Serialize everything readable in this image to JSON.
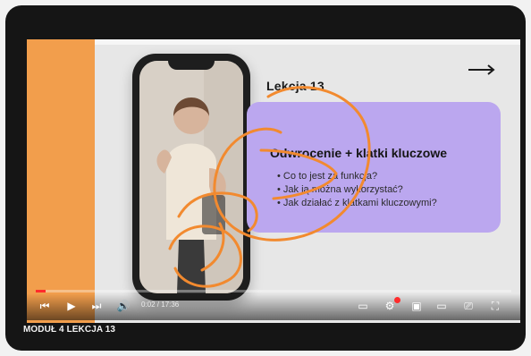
{
  "video": {
    "lesson_title": "Lekcja 13",
    "card_heading": "Odwrocenie + klatki kluczowe",
    "bullets": [
      "Co to jest za funkcja?",
      "Jak ją można wykorzystać?",
      "Jak działać z klatkami kluczowymi?"
    ],
    "time_text": "0:02 / 17:36",
    "progress": 0.02
  },
  "module_label": "MODUŁ 4 LEKCJA 13",
  "colors": {
    "frame": "#151515",
    "left_bar": "#f29e4c",
    "card": "#bba7ef",
    "scribble": "#f28a2f",
    "progress": "#ff2b2b"
  },
  "icons": {
    "next_arrow": "arrow-right-icon",
    "previous": "skip-previous-icon",
    "play": "play-icon",
    "next": "skip-next-icon",
    "volume": "volume-icon",
    "subtitles": "subtitles-icon",
    "settings": "gear-icon",
    "miniplayer": "miniplayer-icon",
    "theater": "theater-icon",
    "cast": "cast-icon",
    "fullscreen": "fullscreen-icon"
  }
}
